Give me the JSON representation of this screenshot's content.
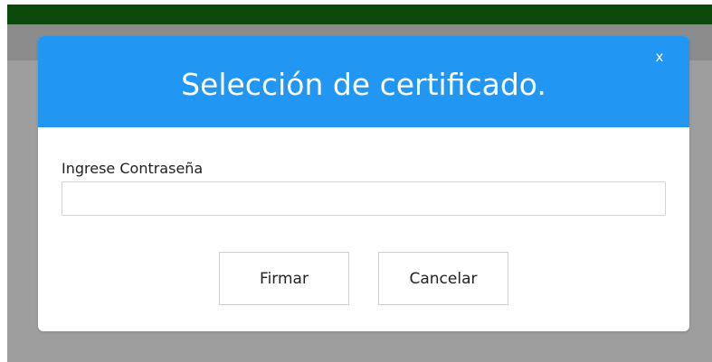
{
  "dialog": {
    "title": "Selección de certificado.",
    "close_label": "x",
    "password_label": "Ingrese Contraseña",
    "password_value": "",
    "sign_button": "Firmar",
    "cancel_button": "Cancelar"
  },
  "colors": {
    "top_bar": "#0b4a0b",
    "header_bar": "#8c8c8c",
    "overlay": "#9e9e9e",
    "modal_header": "#2196f3",
    "modal_body": "#ffffff"
  }
}
